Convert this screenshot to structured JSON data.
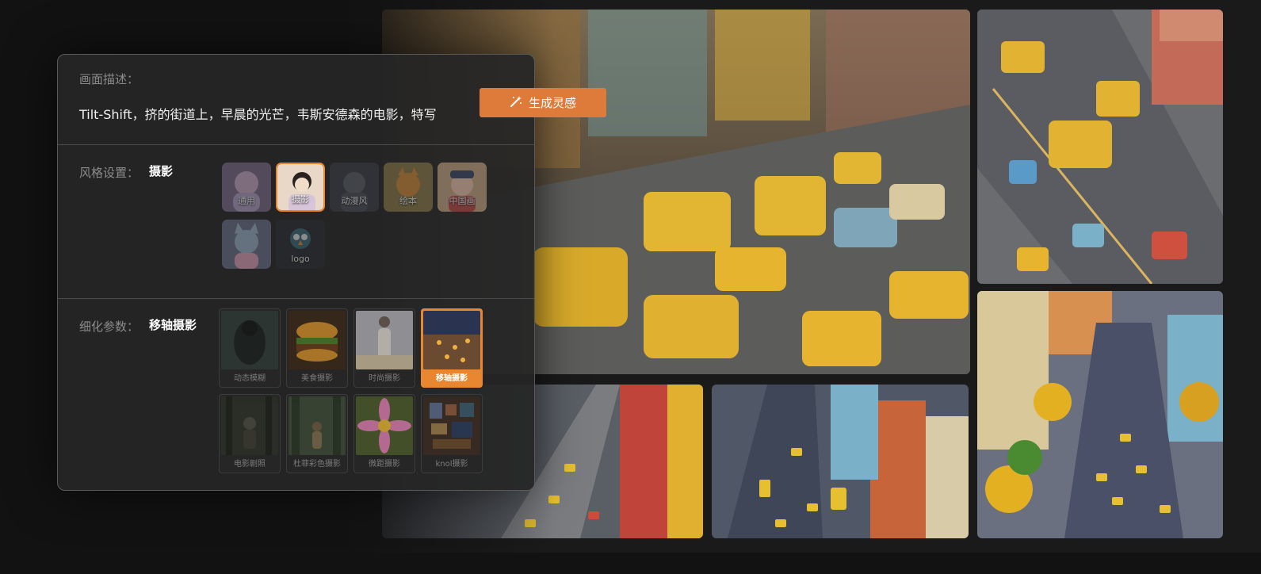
{
  "prompt": {
    "label": "画面描述：",
    "text": "Tilt-Shift，挤的街道上，早晨的光芒，韦斯安德森的电影，特写"
  },
  "generate_button": {
    "label": "生成灵感",
    "icon": "magic-wand-icon"
  },
  "style": {
    "label": "风格设置：",
    "selected": "摄影",
    "options": [
      {
        "label": "通用",
        "color": "#c9a9c4"
      },
      {
        "label": "摄影",
        "color": "#e9d8c8",
        "active": true
      },
      {
        "label": "动漫风",
        "color": "#3a3f48"
      },
      {
        "label": "绘本",
        "color": "#b08a56"
      },
      {
        "label": "中国画",
        "color": "#d89a78"
      },
      {
        "label": "",
        "color": "#8a8fa8"
      },
      {
        "label": "logo",
        "color": "#2a2d33"
      }
    ]
  },
  "refine": {
    "label": "细化参数：",
    "selected": "移轴摄影",
    "options": [
      {
        "label": "动态模糊",
        "color": "#2f3a36"
      },
      {
        "label": "美食摄影",
        "color": "#7a4a22"
      },
      {
        "label": "时尚摄影",
        "color": "#a9a9b0"
      },
      {
        "label": "移轴摄影",
        "color": "#2a3450",
        "active": true
      },
      {
        "label": "电影剧照",
        "color": "#2c3026"
      },
      {
        "label": "杜菲彩色摄影",
        "color": "#3d4a36"
      },
      {
        "label": "微距摄影",
        "color": "#c76a9c"
      },
      {
        "label": "knol摄影",
        "color": "#3a2c22"
      }
    ]
  },
  "colors": {
    "accent": "#e8872f",
    "button": "#de7a3a"
  }
}
